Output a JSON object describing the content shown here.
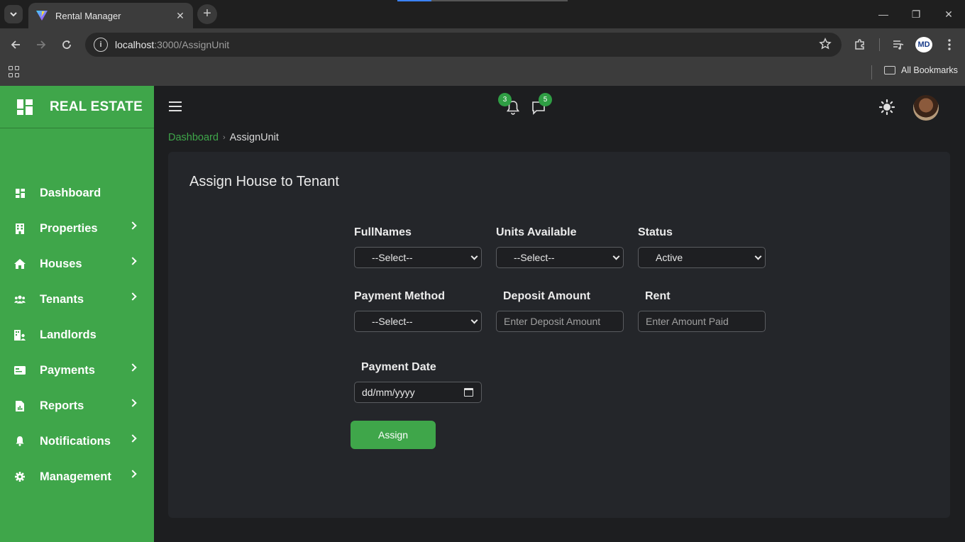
{
  "browser": {
    "tab_title": "Rental Manager",
    "tab_close": "✕",
    "new_tab": "+",
    "url_host": "localhost",
    "url_path": ":3000/AssignUnit",
    "profile_initials": "MD",
    "all_bookmarks": "All Bookmarks",
    "window_controls": {
      "minimize": "—",
      "restore": "❐",
      "close": "✕"
    }
  },
  "brand": {
    "name": "REAL ESTATE",
    "accent": "#3fa64a"
  },
  "sidebar": {
    "items": [
      {
        "label": "Dashboard",
        "icon": "dashboard-icon",
        "has_submenu": false
      },
      {
        "label": "Properties",
        "icon": "building-icon",
        "has_submenu": true
      },
      {
        "label": "Houses",
        "icon": "home-icon",
        "has_submenu": true
      },
      {
        "label": "Tenants",
        "icon": "users-icon",
        "has_submenu": true
      },
      {
        "label": "Landlords",
        "icon": "landlord-icon",
        "has_submenu": false
      },
      {
        "label": "Payments",
        "icon": "payment-card-icon",
        "has_submenu": true
      },
      {
        "label": "Reports",
        "icon": "report-icon",
        "has_submenu": true
      },
      {
        "label": "Notifications",
        "icon": "bell-icon",
        "has_submenu": true
      },
      {
        "label": "Management",
        "icon": "gear-icon",
        "has_submenu": true
      }
    ]
  },
  "topbar": {
    "notification_count": "3",
    "message_count": "5"
  },
  "breadcrumb": {
    "parent": "Dashboard",
    "separator": "›",
    "current": "AssignUnit"
  },
  "form": {
    "title": "Assign House to Tenant",
    "fullnames": {
      "label": "FullNames",
      "value": "--Select--"
    },
    "units": {
      "label": "Units Available",
      "value": "--Select--"
    },
    "status": {
      "label": "Status",
      "value": "Active"
    },
    "payment_method": {
      "label": "Payment Method",
      "value": "--Select--"
    },
    "deposit": {
      "label": "Deposit Amount",
      "placeholder": "Enter Deposit Amount"
    },
    "rent": {
      "label": "Rent",
      "placeholder": "Enter Amount Paid"
    },
    "payment_date": {
      "label": "Payment Date",
      "value": "dd/mm/yyyy"
    },
    "submit_label": "Assign"
  }
}
